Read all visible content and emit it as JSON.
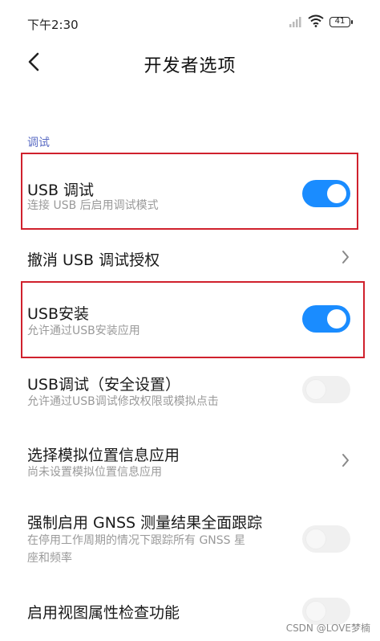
{
  "status_bar": {
    "time": "下午2:30",
    "battery": "41"
  },
  "header": {
    "title": "开发者选项",
    "back_icon": "chevron-left-icon"
  },
  "section": {
    "label": "调试"
  },
  "items": [
    {
      "title": "USB 调试",
      "subtitle": "连接 USB 后启用调试模式",
      "control": "toggle",
      "state": "on"
    },
    {
      "title": "撤消 USB 调试授权",
      "subtitle": "",
      "control": "chevron",
      "state": ""
    },
    {
      "title": "USB安装",
      "subtitle": "允许通过USB安装应用",
      "control": "toggle",
      "state": "on"
    },
    {
      "title": "USB调试（安全设置）",
      "subtitle": "允许通过USB调试修改权限或模拟点击",
      "control": "toggle",
      "state": "off"
    },
    {
      "title": "选择模拟位置信息应用",
      "subtitle": "尚未设置模拟位置信息应用",
      "control": "chevron",
      "state": ""
    },
    {
      "title": "强制启用 GNSS 测量结果全面跟踪",
      "subtitle_line1": "在停用工作周期的情况下跟踪所有 GNSS 星",
      "subtitle_line2": "座和频率",
      "control": "toggle",
      "state": "off"
    },
    {
      "title": "启用视图属性检查功能",
      "subtitle": "",
      "control": "toggle",
      "state": "off"
    }
  ],
  "colors": {
    "accent": "#1a8cff",
    "section_label": "#5b6cc4",
    "highlight_border": "#d0212d"
  },
  "watermark": "CSDN @LOVE梦楠"
}
